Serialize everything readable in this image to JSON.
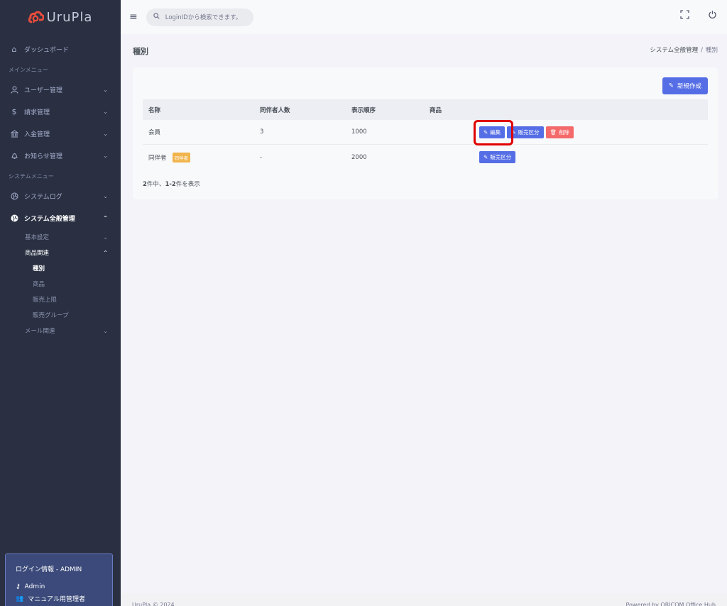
{
  "brand": {
    "name": "UruPla",
    "color": "#e74c3c"
  },
  "sidebar": {
    "dashboard": "ダッシュボード",
    "main_menu_title": "メインメニュー",
    "main_items": [
      {
        "label": "ユーザー管理",
        "icon": "user-icon"
      },
      {
        "label": "請求管理",
        "icon": "dollar-icon"
      },
      {
        "label": "入金管理",
        "icon": "bank-icon"
      },
      {
        "label": "お知らせ管理",
        "icon": "bell-icon"
      }
    ],
    "system_menu_title": "システムメニュー",
    "system_log": "システムログ",
    "system_admin": "システム全般管理",
    "sub": {
      "basic": "基本設定",
      "product_rel": "商品関連",
      "type": "種別",
      "product": "商品",
      "sales_limit": "販売上限",
      "sales_group": "販売グループ",
      "mail_rel": "メール関連"
    },
    "login": {
      "title": "ログイン情報 - ADMIN",
      "user": "Admin",
      "role": "マニュアル用管理者"
    }
  },
  "topbar": {
    "search_placeholder": "LoginIDから検索できます。"
  },
  "page": {
    "title": "種別",
    "breadcrumb_parent": "システム全般管理",
    "breadcrumb_sep": "/",
    "breadcrumb_current": "種別"
  },
  "toolbar": {
    "new_label": "新規作成"
  },
  "table": {
    "headers": [
      "名称",
      "同伴者人数",
      "表示順序",
      "商品"
    ],
    "rows": [
      {
        "name": "会員",
        "badge": "",
        "companions": "3",
        "order": "1000",
        "edit": "編集",
        "sales": "販売区分",
        "delete": "削除"
      },
      {
        "name": "同伴者",
        "badge": "同伴者",
        "companions": "-",
        "order": "2000",
        "sales": "販売区分"
      }
    ],
    "count_total": "2",
    "count_mid": "件中、",
    "count_range": "1-2",
    "count_suffix": "件を表示"
  },
  "footer": {
    "left": "UruPla © 2024",
    "right": "Powered by ORICOM Office Hub"
  }
}
